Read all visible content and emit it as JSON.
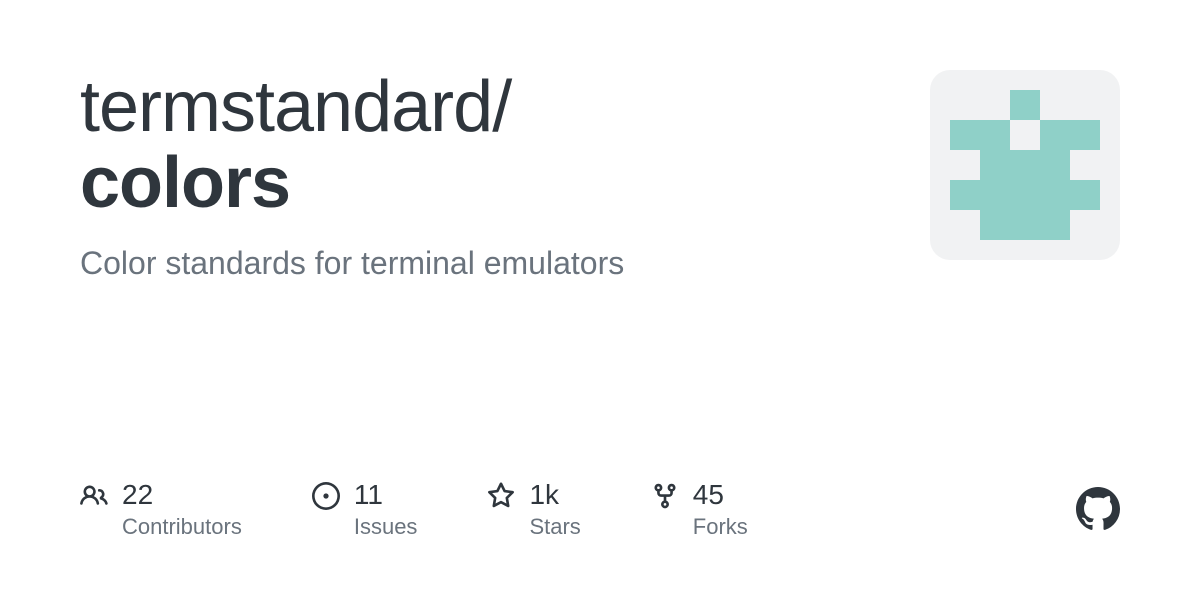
{
  "repo": {
    "owner": "termstandard",
    "slash": "/",
    "name": "colors",
    "description": "Color standards for terminal emulators"
  },
  "stats": {
    "contributors": {
      "value": "22",
      "label": "Contributors"
    },
    "issues": {
      "value": "11",
      "label": "Issues"
    },
    "stars": {
      "value": "1k",
      "label": "Stars"
    },
    "forks": {
      "value": "45",
      "label": "Forks"
    }
  },
  "colors": {
    "identicon": "#8fd0c8",
    "avatar_bg": "#f1f2f3",
    "text_primary": "#2f363d",
    "text_secondary": "#6a737d"
  }
}
